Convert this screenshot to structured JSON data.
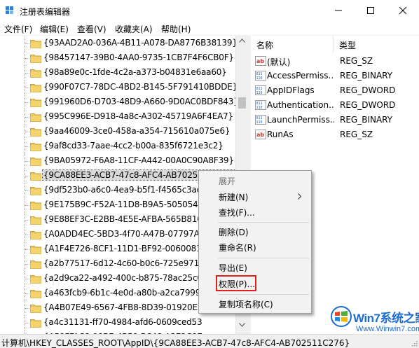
{
  "window": {
    "title": "注册表编辑器",
    "minimize_icon": "minimize-icon",
    "maximize_icon": "maximize-icon",
    "close_icon": "close-icon"
  },
  "menu": [
    "文件(F)",
    "编辑(E)",
    "查看(V)",
    "收藏夹(A)",
    "帮助(H)"
  ],
  "tree": {
    "items": [
      "{93AAD2A0-036A-4B11-A078-DA8776B38139}",
      "{98457147-39B0-4AA0-9735-1CB7F4F6CB0F}",
      "{98a89e0c-1fde-4c2a-a373-b04831e6aa60}",
      "{990F07C7-78DC-4BD2-B145-5F791410BDDE}",
      "{991960D6-D703-48D9-A660-9D0AC0BDF843}",
      "{995C996E-D918-4a8c-A302-45719A6F4EA7}",
      "{9aa46009-3ce0-458a-a354-715610a075e6}",
      "{9af8cd33-7aae-4cc2-b00a-835f6721e3c2}",
      "{9BA05972-F6A8-11CF-A442-00A0C90A8F39}",
      "{9CA88EE3-ACB7-47c8-AFC4-AB702511C276}",
      "{9df523b0-a6c0-4ea9-b5f1-f4565c3ac",
      "{9E175B9C-F52A-11D8-B9A5-5050545",
      "{9E88EF3C-E2BB-4E5E-AFBA-565B810",
      "{A0ADD4EC-5BD3-4f70-A47B-07797A",
      "{A1F4E726-8CF1-11D1-BF92-0060081",
      "{a2b77517-6d12-4c60-b0c6-725e971",
      "{a2d9ca22-a492-400c-b875-78ac25c0",
      "{a463fcb9-6b1c-4e0d-a80b-a2ca7999",
      "{A4B07E49-6567-4FB8-8D39-01920E3",
      "{a4c31131-ff70-4984-afd6-0609ced53",
      "{A50FFAC8-99BE-4B59-BC48-A3E2C8E"
    ],
    "selected_index": 9
  },
  "values": {
    "headers": {
      "name": "名称",
      "type": "类型"
    },
    "rows": [
      {
        "name": "(默认)",
        "type": "REG_SZ",
        "icon": "string-value-icon"
      },
      {
        "name": "AccessPermiss...",
        "type": "REG_BINARY",
        "icon": "binary-value-icon"
      },
      {
        "name": "AppIDFlags",
        "type": "REG_DWORD",
        "icon": "binary-value-icon"
      },
      {
        "name": "Authentication...",
        "type": "REG_DWORD",
        "icon": "binary-value-icon"
      },
      {
        "name": "LaunchPermiss...",
        "type": "REG_BINARY",
        "icon": "binary-value-icon"
      },
      {
        "name": "RunAs",
        "type": "REG_SZ",
        "icon": "string-value-icon"
      }
    ]
  },
  "context_menu": {
    "expand": "展开",
    "new": "新建(N)",
    "find": "查找(F)...",
    "delete": "删除(D)",
    "rename": "重命名(R)",
    "export": "导出(E)",
    "permissions": "权限(P)...",
    "copy_key_name": "复制项名称(C)"
  },
  "status": {
    "path": "计算机\\HKEY_CLASSES_ROOT\\AppID\\{9CA88EE3-ACB7-47c8-AFC4-AB702511C276}"
  },
  "watermark": {
    "title": "Win7系统之家",
    "url": "Www.Winwin7.com"
  },
  "colors": {
    "highlight_box": "#e0221d",
    "folder": "#e8c25a",
    "watermark": "#1e6ccf"
  }
}
